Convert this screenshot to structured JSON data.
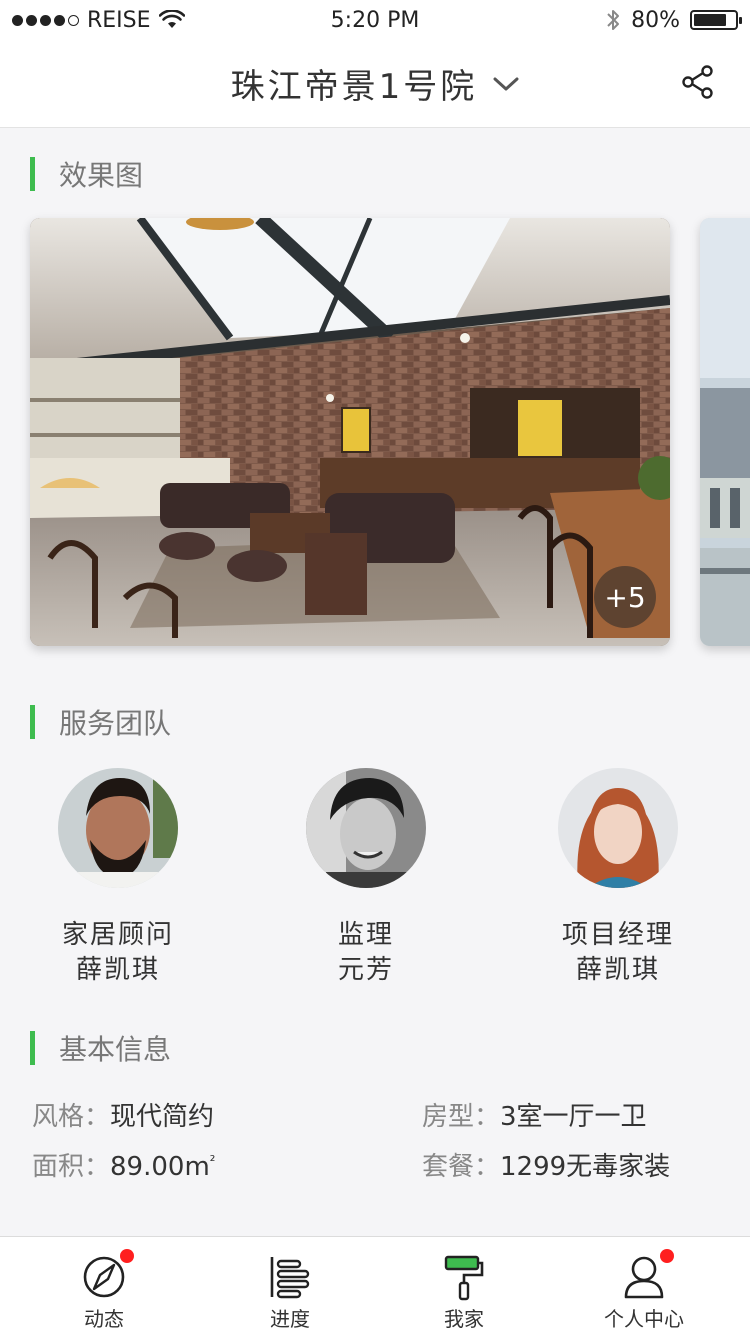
{
  "status_bar": {
    "carrier": "REISE",
    "time": "5:20 PM",
    "battery": "80%",
    "battery_level": 0.8,
    "icons": [
      "signal-dots",
      "wifi-icon",
      "bluetooth-icon",
      "battery-icon"
    ]
  },
  "nav": {
    "title": "珠江帝景1号院",
    "dropdown_icon": "chevron-down-icon",
    "share_icon": "share-icon"
  },
  "renderings": {
    "title": "效果图",
    "more_count": "+5"
  },
  "team": {
    "title": "服务团队",
    "members": [
      {
        "role": "家居顾问",
        "name": "薛凯琪"
      },
      {
        "role": "监理",
        "name": "元芳"
      },
      {
        "role": "项目经理",
        "name": "薛凯琪"
      }
    ]
  },
  "info": {
    "title": "基本信息",
    "style_label": "风格：",
    "style_value": "现代简约",
    "layout_label": "房型：",
    "layout_value": "3室一厅一卫",
    "area_label": "面积：",
    "area_value": "89.00m",
    "area_unit_sup": "²",
    "package_label": "套餐：",
    "package_value": "1299无毒家装"
  },
  "tabs": [
    {
      "label": "动态",
      "icon": "compass-icon",
      "badge": true
    },
    {
      "label": "进度",
      "icon": "progress-icon",
      "badge": false
    },
    {
      "label": "我家",
      "icon": "paint-roller-icon",
      "badge": false
    },
    {
      "label": "个人中心",
      "icon": "person-icon",
      "badge": true
    }
  ],
  "colors": {
    "accent_green": "#3ebc4f",
    "badge_red": "#ff1f1f"
  }
}
